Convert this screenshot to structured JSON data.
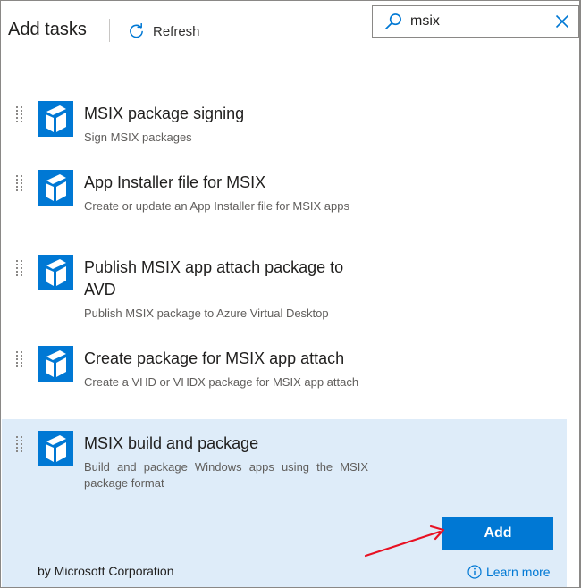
{
  "header": {
    "title": "Add tasks",
    "refresh_label": "Refresh",
    "refresh_icon": "refresh-icon"
  },
  "search": {
    "value": "msix",
    "icon": "search-icon",
    "clear_icon": "close-icon"
  },
  "tasks": [
    {
      "name": "MSIX package signing",
      "description": "Sign MSIX packages",
      "icon": "package-icon",
      "selected": false
    },
    {
      "name": "App Installer file for MSIX",
      "description": "Create or update an App Installer file for MSIX apps",
      "icon": "package-icon",
      "selected": false
    },
    {
      "name": "Publish MSIX app attach package to AVD",
      "description": "Publish MSIX package to Azure Virtual Desktop",
      "icon": "package-icon",
      "selected": false
    },
    {
      "name": "Create package for MSIX app attach",
      "description": "Create a VHD or VHDX package for MSIX app attach",
      "icon": "package-icon",
      "selected": false
    },
    {
      "name": "MSIX build and package",
      "description": "Build and package Windows apps using the MSIX package format",
      "icon": "package-icon",
      "selected": true
    }
  ],
  "selected_task": {
    "add_label": "Add",
    "publisher": "by Microsoft Corporation",
    "learn_more_label": "Learn more",
    "learn_more_icon": "info-icon"
  },
  "colors": {
    "accent": "#0078d4",
    "selected_bg": "#deecf9",
    "annotation_arrow": "#e81123"
  }
}
